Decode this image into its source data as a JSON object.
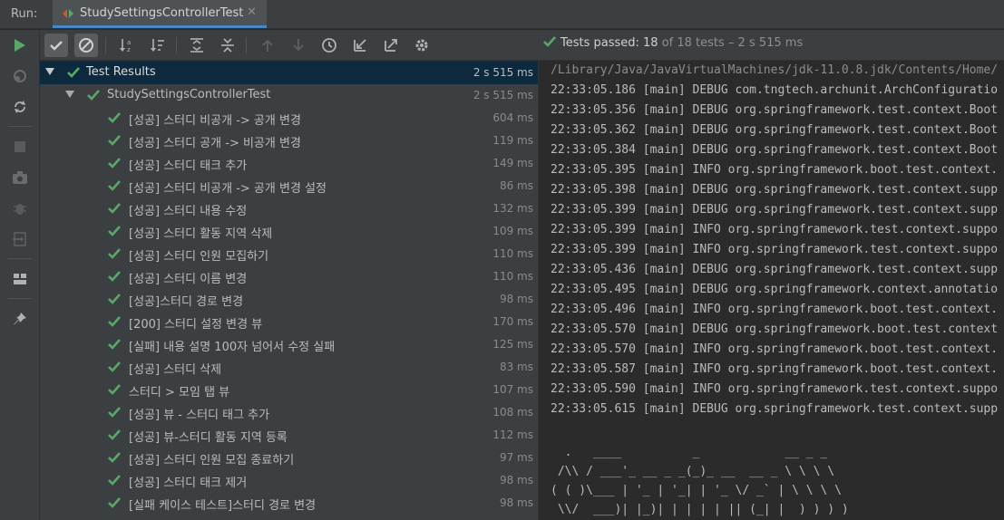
{
  "tabbar": {
    "run_label": "Run:",
    "tab_title": "StudySettingsControllerTest",
    "close_glyph": "✕"
  },
  "status": {
    "passed_text": "Tests passed: 18",
    "rest_text": " of 18 tests – 2 s 515 ms"
  },
  "tree": {
    "root": {
      "name": "Test Results",
      "duration": "2 s 515 ms"
    },
    "suite": {
      "name": "StudySettingsControllerTest",
      "duration": "2 s 515 ms"
    },
    "tests": [
      {
        "name": "[성공] 스터디 비공개 -> 공개 변경",
        "duration": "604 ms"
      },
      {
        "name": "[성공] 스터디 공개 -> 비공개 변경",
        "duration": "119 ms"
      },
      {
        "name": "[성공] 스터디 태크 추가",
        "duration": "149 ms"
      },
      {
        "name": "[성공] 스터디 비공개 -> 공개 변경 설정",
        "duration": "86 ms"
      },
      {
        "name": "[성공] 스터디 내용 수정",
        "duration": "132 ms"
      },
      {
        "name": "[성공] 스터디 활동 지역 삭제",
        "duration": "109 ms"
      },
      {
        "name": "[성공] 스터디 인원 모집하기",
        "duration": "110 ms"
      },
      {
        "name": "[성공] 스터디 이름 변경",
        "duration": "110 ms"
      },
      {
        "name": "[성공]스터디 경로 변경",
        "duration": "98 ms"
      },
      {
        "name": "[200] 스터디 설정 변경 뷰",
        "duration": "170 ms"
      },
      {
        "name": "[실패] 내용 설명 100자 넘어서 수정 실패",
        "duration": "125 ms"
      },
      {
        "name": "[성공] 스터디 삭제",
        "duration": "83 ms"
      },
      {
        "name": "스터디 > 모임 탭 뷰",
        "duration": "107 ms"
      },
      {
        "name": "[성공] 뷰 - 스터디 태그 추가",
        "duration": "108 ms"
      },
      {
        "name": "[성공] 뷰-스터디 활동 지역 등록",
        "duration": "112 ms"
      },
      {
        "name": "[성공] 스터디 인원 모집 종료하기",
        "duration": "97 ms"
      },
      {
        "name": "[성공] 스터디 태크 제거",
        "duration": "98 ms"
      },
      {
        "name": "[실패 케이스 테스트]스터디 경로 변경",
        "duration": "98 ms"
      }
    ]
  },
  "console": {
    "path_line": "/Library/Java/JavaVirtualMachines/jdk-11.0.8.jdk/Contents/Home/",
    "lines": [
      "22:33:05.186 [main] DEBUG com.tngtech.archunit.ArchConfiguratio",
      "22:33:05.356 [main] DEBUG org.springframework.test.context.Boot",
      "22:33:05.362 [main] DEBUG org.springframework.test.context.Boot",
      "22:33:05.384 [main] DEBUG org.springframework.test.context.Boot",
      "22:33:05.395 [main] INFO org.springframework.boot.test.context.",
      "22:33:05.398 [main] DEBUG org.springframework.test.context.supp",
      "22:33:05.399 [main] DEBUG org.springframework.test.context.supp",
      "22:33:05.399 [main] INFO org.springframework.test.context.suppo",
      "22:33:05.399 [main] INFO org.springframework.test.context.suppo",
      "22:33:05.436 [main] DEBUG org.springframework.test.context.supp",
      "22:33:05.495 [main] DEBUG org.springframework.context.annotatio",
      "22:33:05.496 [main] INFO org.springframework.boot.test.context.",
      "22:33:05.570 [main] DEBUG org.springframework.boot.test.context",
      "22:33:05.570 [main] INFO org.springframework.boot.test.context.",
      "22:33:05.587 [main] INFO org.springframework.boot.test.context.",
      "22:33:05.590 [main] INFO org.springframework.test.context.suppo",
      "22:33:05.615 [main] DEBUG org.springframework.test.context.supp"
    ],
    "banner": [
      "  .   ____          _            __ _ _",
      " /\\\\ / ___'_ __ _ _(_)_ __  __ _ \\ \\ \\ \\",
      "( ( )\\___ | '_ | '_| | '_ \\/ _` | \\ \\ \\ \\",
      " \\\\/  ___)| |_)| | | | | || (_| |  ) ) ) )"
    ]
  },
  "colors": {
    "check_green": "#59a869",
    "selection_bg": "#0d293e",
    "accent_blue": "#4a88c7"
  }
}
